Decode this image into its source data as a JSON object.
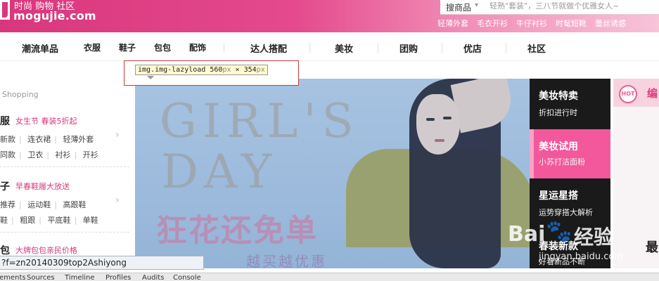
{
  "header": {
    "logo_tagline": "时尚 购物 社区",
    "logo_url": "mogujie.com",
    "search": {
      "category": "搜商品",
      "placeholder": "轻熟\"套装\"，三八节就做个优雅女人~"
    },
    "hot_links": [
      "轻薄外套",
      "毛衣开衫",
      "牛仔衬衫",
      "时髦短靴",
      "蕾丝诱惑"
    ]
  },
  "nav": {
    "items": [
      "潮流单品",
      "衣服",
      "鞋子",
      "包包",
      "配饰",
      "达人搭配",
      "美妆",
      "团购",
      "优店",
      "社区"
    ]
  },
  "devtools_tip": {
    "selector": "img.img-lazyload",
    "width": "560",
    "height": "354",
    "unit": "px",
    "times": "×"
  },
  "sidebar": {
    "heading": "Shopping",
    "groups": [
      {
        "title": "服",
        "promo": "女生节 春装5折起",
        "rows": [
          [
            "新款",
            "连衣裙",
            "轻薄外套"
          ],
          [
            "同款",
            "卫衣",
            "衬衫",
            "开衫"
          ]
        ]
      },
      {
        "title": "子",
        "promo": "早春鞋履大放送",
        "rows": [
          [
            "推荐",
            "运动鞋",
            "高跟鞋"
          ],
          [
            "鞋",
            "粗跟",
            "平底鞋",
            "单鞋"
          ]
        ]
      },
      {
        "title": "包",
        "promo": "大牌包包亲民价格",
        "rows": []
      }
    ]
  },
  "banner": {
    "headline_1": "GIRL'S",
    "headline_2": "DAY",
    "slogan": "狂花还免单",
    "subslogan": "越买越优惠"
  },
  "promos": [
    {
      "title": "美妆特卖",
      "subtitle": "折扣进行时"
    },
    {
      "title": "美妆试用",
      "subtitle": "小苏打洁面粉"
    },
    {
      "title": "星运星搭",
      "subtitle": "运势穿搭大解析"
    },
    {
      "title": "春装新款",
      "subtitle": "好看新品不断"
    }
  ],
  "right_ad": {
    "hot_label": "HOT",
    "text": "编",
    "bottom_text": "最"
  },
  "watermark": {
    "bai": "Bai",
    "jingyan": "经验",
    "url": "jingyan.baidu.com"
  },
  "status_bar": {
    "text": "?f=zn20140309top2Ashiyong"
  },
  "devtools_tabs": [
    "Elements",
    "Sources",
    "Timeline",
    "Profiles",
    "Audits",
    "Console"
  ],
  "colors": {
    "brand": "#d9377d",
    "promo_pink": "#f2589b"
  }
}
